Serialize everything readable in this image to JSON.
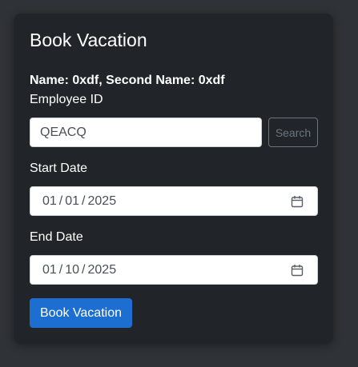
{
  "form": {
    "title": "Book Vacation",
    "name_line": "Name: 0xdf, Second Name: 0xdf",
    "employee_id_label": "Employee ID",
    "employee_id_value": "QEACQ",
    "search_label": "Search",
    "start_date_label": "Start Date",
    "start_date": {
      "month": "01",
      "day": "01",
      "year": "2025"
    },
    "end_date_label": "End Date",
    "end_date": {
      "month": "01",
      "day": "10",
      "year": "2025"
    },
    "date_separator": "/",
    "submit_label": "Book Vacation"
  },
  "icons": {
    "date_picker": "calendar-icon"
  },
  "colors": {
    "page_background": "#2f3236",
    "card_background": "#212529",
    "primary_button": "#1c6fd1",
    "outline_button": "#6c757d"
  }
}
